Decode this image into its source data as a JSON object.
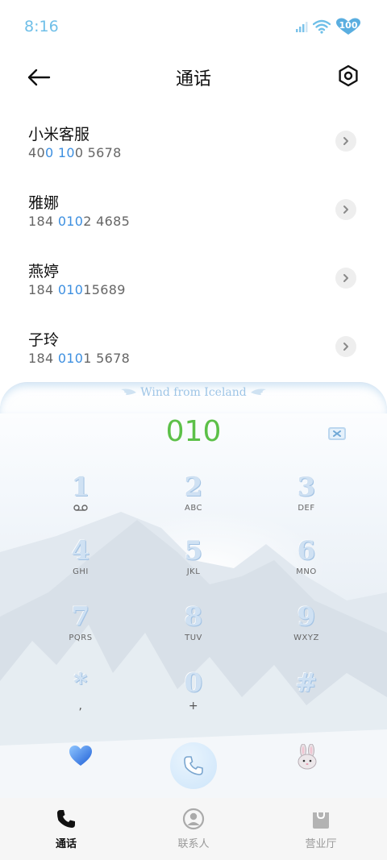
{
  "status_bar": {
    "time": "8:16",
    "battery": "100"
  },
  "header": {
    "title": "通话"
  },
  "contacts": [
    {
      "name": "小米客服",
      "number_parts": [
        "40",
        "0",
        " ",
        "10",
        "0 5678"
      ]
    },
    {
      "name": "雅娜",
      "number_parts": [
        "184 ",
        "010",
        "2 4685"
      ]
    },
    {
      "name": "燕婷",
      "number_parts": [
        "184 ",
        "010",
        "15689"
      ]
    },
    {
      "name": "子玲",
      "number_parts": [
        "184 ",
        "010",
        "1 5678"
      ]
    }
  ],
  "dialer": {
    "theme_title": "Wind from Iceland",
    "dialed_number": "010",
    "keys": [
      {
        "digit": "1",
        "letters": ""
      },
      {
        "digit": "2",
        "letters": "ABC"
      },
      {
        "digit": "3",
        "letters": "DEF"
      },
      {
        "digit": "4",
        "letters": "GHI"
      },
      {
        "digit": "5",
        "letters": "JKL"
      },
      {
        "digit": "6",
        "letters": "MNO"
      },
      {
        "digit": "7",
        "letters": "PQRS"
      },
      {
        "digit": "8",
        "letters": "TUV"
      },
      {
        "digit": "9",
        "letters": "WXYZ"
      },
      {
        "digit": "*",
        "letters": ","
      },
      {
        "digit": "0",
        "letters": "+"
      },
      {
        "digit": "#",
        "letters": ""
      }
    ]
  },
  "bottom_nav": [
    {
      "label": "通话",
      "icon": "phone-icon",
      "active": true
    },
    {
      "label": "联系人",
      "icon": "contact-icon",
      "active": false
    },
    {
      "label": "营业厅",
      "icon": "shop-bag-icon",
      "active": false
    }
  ],
  "colors": {
    "accent": "#3d8fe0",
    "dialed": "#5cc048",
    "banner": "#9ec5e6"
  }
}
